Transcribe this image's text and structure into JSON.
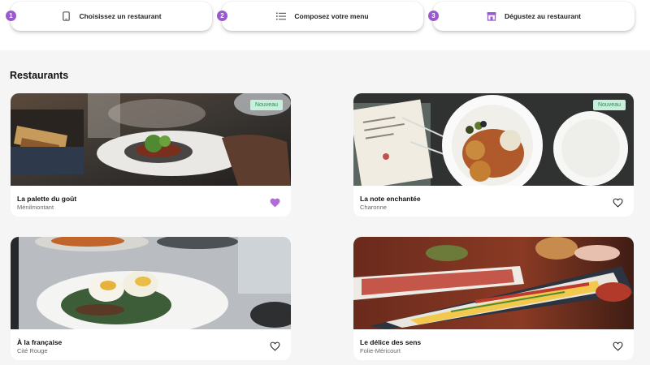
{
  "steps": [
    {
      "number": "1",
      "label": "Choisissez un restaurant",
      "icon": "smartphone-icon"
    },
    {
      "number": "2",
      "label": "Composez votre menu",
      "icon": "list-icon"
    },
    {
      "number": "3",
      "label": "Dégustez au restaurant",
      "icon": "storefront-icon"
    }
  ],
  "section_title": "Restaurants",
  "restaurants": [
    {
      "name": "La palette du goût",
      "area": "Ménilmontant",
      "badge": "Nouveau",
      "favorite": true
    },
    {
      "name": "La note enchantée",
      "area": "Charonne",
      "badge": "Nouveau",
      "favorite": false
    },
    {
      "name": "À la française",
      "area": "Cité Rouge",
      "badge": "",
      "favorite": false
    },
    {
      "name": "Le délice des sens",
      "area": "Folie-Méricourt",
      "badge": "",
      "favorite": false
    }
  ],
  "colors": {
    "accent": "#9b59d0",
    "badge_bg": "#c8efdc",
    "badge_text": "#2f8a5a",
    "page_bg": "#f5f5f5"
  }
}
